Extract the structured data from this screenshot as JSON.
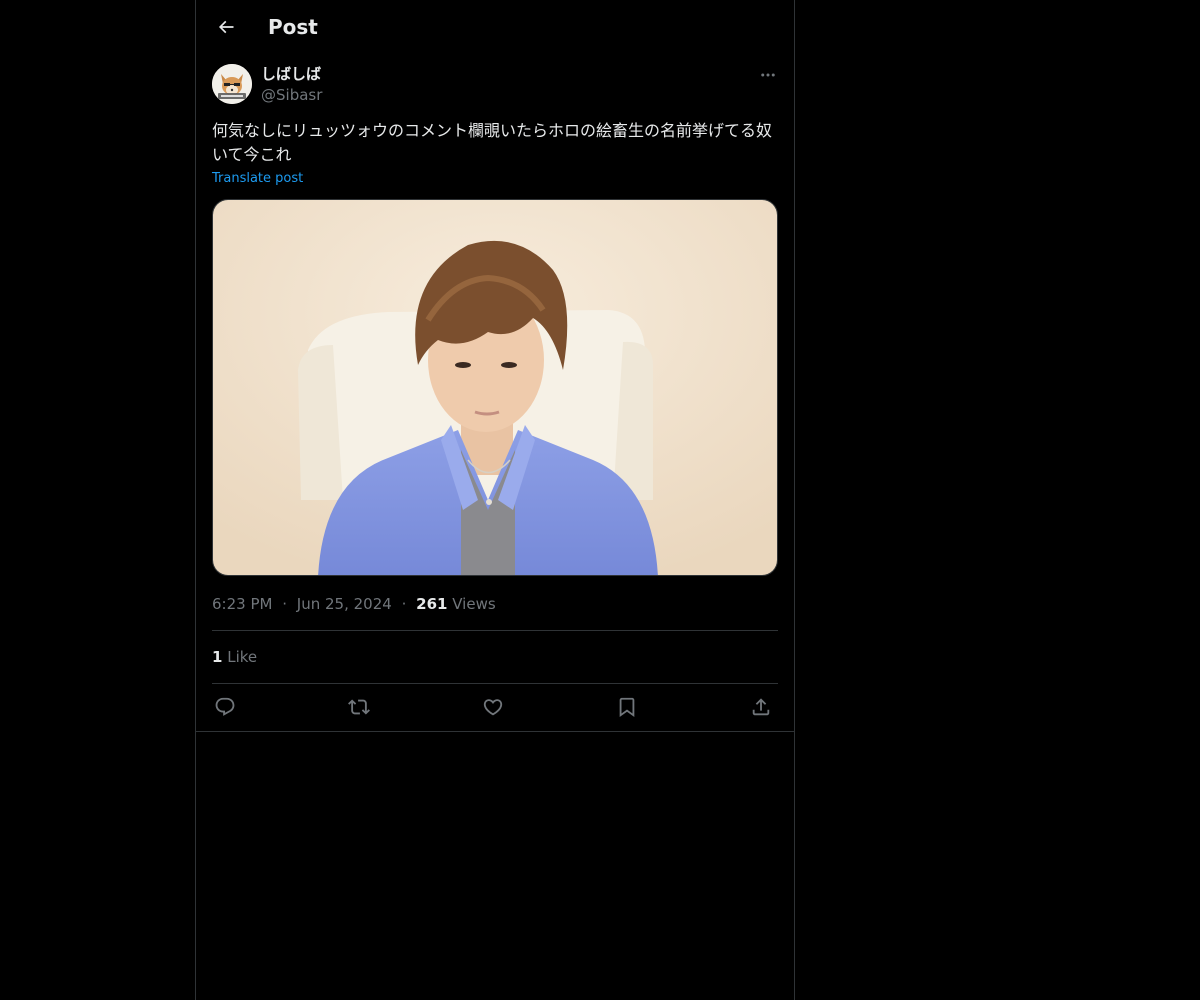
{
  "header": {
    "back_icon": "arrow-left-icon",
    "title": "Post"
  },
  "author": {
    "avatar_icon": "fox-avatar-icon",
    "display_name": "しばしば",
    "handle": "@Sibasr"
  },
  "post": {
    "more_icon": "ellipsis-icon",
    "text": "何気なしにリュッツォウのコメント欄覗いたらホロの絵畜生の名前挙げてる奴いて今これ",
    "translate_label": "Translate post",
    "media_alt": "Image"
  },
  "meta": {
    "time": "6:23 PM",
    "separator": "·",
    "date": "Jun 25, 2024",
    "views_count": "261",
    "views_label": "Views"
  },
  "engagement": {
    "likes_count": "1",
    "likes_label": "Like"
  },
  "actions": [
    {
      "name": "reply",
      "icon": "reply-icon"
    },
    {
      "name": "repost",
      "icon": "repost-icon"
    },
    {
      "name": "like",
      "icon": "heart-icon"
    },
    {
      "name": "bookmark",
      "icon": "bookmark-icon"
    },
    {
      "name": "share",
      "icon": "share-icon"
    }
  ],
  "colors": {
    "background": "#000000",
    "text_primary": "#e7e9ea",
    "text_secondary": "#71767b",
    "accent": "#1d9bf0",
    "border": "#2f3336"
  }
}
